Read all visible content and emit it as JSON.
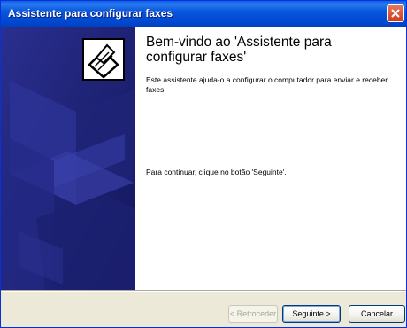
{
  "window": {
    "title": "Assistente para configurar faxes"
  },
  "main": {
    "heading": "Bem-vindo ao 'Assistente para configurar faxes'",
    "intro": "Este assistente ajuda-o a configurar o computador para enviar e receber faxes.",
    "continue_text": "Para continuar, clique no botão 'Seguinte'."
  },
  "buttons": {
    "back": "< Retroceder",
    "next": "Seguinte >",
    "cancel": "Cancelar"
  },
  "icons": {
    "close": "close-icon",
    "wizard": "fax-machine-icon"
  },
  "colors": {
    "title_bar": "#0054E3",
    "side_panel": "#1A1C72",
    "close_button": "#D9532F"
  }
}
